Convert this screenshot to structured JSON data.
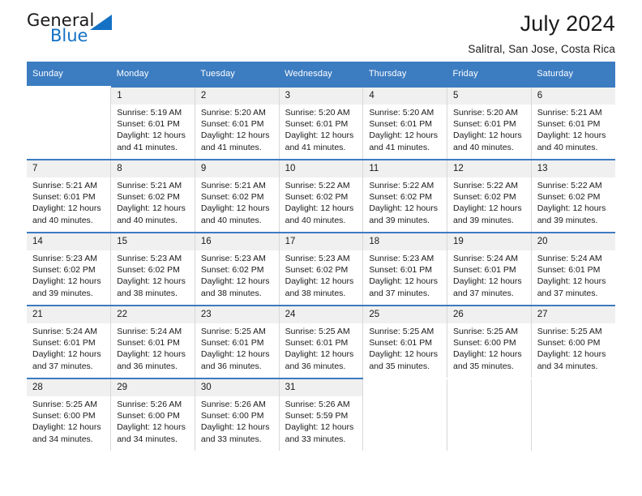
{
  "logo": {
    "word_top": "General",
    "word_bottom": "Blue",
    "triangle_color": "#1471c4",
    "icon": "general-blue-logo"
  },
  "header": {
    "title": "July 2024",
    "subtitle": "Salitral, San Jose, Costa Rica"
  },
  "theme": {
    "header_blue": "#3c7cc1",
    "daynum_band": "#f0f0f0",
    "text": "#1a1a1a"
  },
  "calendar": {
    "weekday_headers": [
      "Sunday",
      "Monday",
      "Tuesday",
      "Wednesday",
      "Thursday",
      "Friday",
      "Saturday"
    ],
    "weeks": [
      [
        {
          "day": "",
          "sunrise": "",
          "sunset": "",
          "daylight_line1": "",
          "daylight_line2": "",
          "empty": true
        },
        {
          "day": "1",
          "sunrise": "Sunrise: 5:19 AM",
          "sunset": "Sunset: 6:01 PM",
          "daylight_line1": "Daylight: 12 hours",
          "daylight_line2": "and 41 minutes."
        },
        {
          "day": "2",
          "sunrise": "Sunrise: 5:20 AM",
          "sunset": "Sunset: 6:01 PM",
          "daylight_line1": "Daylight: 12 hours",
          "daylight_line2": "and 41 minutes."
        },
        {
          "day": "3",
          "sunrise": "Sunrise: 5:20 AM",
          "sunset": "Sunset: 6:01 PM",
          "daylight_line1": "Daylight: 12 hours",
          "daylight_line2": "and 41 minutes."
        },
        {
          "day": "4",
          "sunrise": "Sunrise: 5:20 AM",
          "sunset": "Sunset: 6:01 PM",
          "daylight_line1": "Daylight: 12 hours",
          "daylight_line2": "and 41 minutes."
        },
        {
          "day": "5",
          "sunrise": "Sunrise: 5:20 AM",
          "sunset": "Sunset: 6:01 PM",
          "daylight_line1": "Daylight: 12 hours",
          "daylight_line2": "and 40 minutes."
        },
        {
          "day": "6",
          "sunrise": "Sunrise: 5:21 AM",
          "sunset": "Sunset: 6:01 PM",
          "daylight_line1": "Daylight: 12 hours",
          "daylight_line2": "and 40 minutes."
        }
      ],
      [
        {
          "day": "7",
          "sunrise": "Sunrise: 5:21 AM",
          "sunset": "Sunset: 6:01 PM",
          "daylight_line1": "Daylight: 12 hours",
          "daylight_line2": "and 40 minutes."
        },
        {
          "day": "8",
          "sunrise": "Sunrise: 5:21 AM",
          "sunset": "Sunset: 6:02 PM",
          "daylight_line1": "Daylight: 12 hours",
          "daylight_line2": "and 40 minutes."
        },
        {
          "day": "9",
          "sunrise": "Sunrise: 5:21 AM",
          "sunset": "Sunset: 6:02 PM",
          "daylight_line1": "Daylight: 12 hours",
          "daylight_line2": "and 40 minutes."
        },
        {
          "day": "10",
          "sunrise": "Sunrise: 5:22 AM",
          "sunset": "Sunset: 6:02 PM",
          "daylight_line1": "Daylight: 12 hours",
          "daylight_line2": "and 40 minutes."
        },
        {
          "day": "11",
          "sunrise": "Sunrise: 5:22 AM",
          "sunset": "Sunset: 6:02 PM",
          "daylight_line1": "Daylight: 12 hours",
          "daylight_line2": "and 39 minutes."
        },
        {
          "day": "12",
          "sunrise": "Sunrise: 5:22 AM",
          "sunset": "Sunset: 6:02 PM",
          "daylight_line1": "Daylight: 12 hours",
          "daylight_line2": "and 39 minutes."
        },
        {
          "day": "13",
          "sunrise": "Sunrise: 5:22 AM",
          "sunset": "Sunset: 6:02 PM",
          "daylight_line1": "Daylight: 12 hours",
          "daylight_line2": "and 39 minutes."
        }
      ],
      [
        {
          "day": "14",
          "sunrise": "Sunrise: 5:23 AM",
          "sunset": "Sunset: 6:02 PM",
          "daylight_line1": "Daylight: 12 hours",
          "daylight_line2": "and 39 minutes."
        },
        {
          "day": "15",
          "sunrise": "Sunrise: 5:23 AM",
          "sunset": "Sunset: 6:02 PM",
          "daylight_line1": "Daylight: 12 hours",
          "daylight_line2": "and 38 minutes."
        },
        {
          "day": "16",
          "sunrise": "Sunrise: 5:23 AM",
          "sunset": "Sunset: 6:02 PM",
          "daylight_line1": "Daylight: 12 hours",
          "daylight_line2": "and 38 minutes."
        },
        {
          "day": "17",
          "sunrise": "Sunrise: 5:23 AM",
          "sunset": "Sunset: 6:02 PM",
          "daylight_line1": "Daylight: 12 hours",
          "daylight_line2": "and 38 minutes."
        },
        {
          "day": "18",
          "sunrise": "Sunrise: 5:23 AM",
          "sunset": "Sunset: 6:01 PM",
          "daylight_line1": "Daylight: 12 hours",
          "daylight_line2": "and 37 minutes."
        },
        {
          "day": "19",
          "sunrise": "Sunrise: 5:24 AM",
          "sunset": "Sunset: 6:01 PM",
          "daylight_line1": "Daylight: 12 hours",
          "daylight_line2": "and 37 minutes."
        },
        {
          "day": "20",
          "sunrise": "Sunrise: 5:24 AM",
          "sunset": "Sunset: 6:01 PM",
          "daylight_line1": "Daylight: 12 hours",
          "daylight_line2": "and 37 minutes."
        }
      ],
      [
        {
          "day": "21",
          "sunrise": "Sunrise: 5:24 AM",
          "sunset": "Sunset: 6:01 PM",
          "daylight_line1": "Daylight: 12 hours",
          "daylight_line2": "and 37 minutes."
        },
        {
          "day": "22",
          "sunrise": "Sunrise: 5:24 AM",
          "sunset": "Sunset: 6:01 PM",
          "daylight_line1": "Daylight: 12 hours",
          "daylight_line2": "and 36 minutes."
        },
        {
          "day": "23",
          "sunrise": "Sunrise: 5:25 AM",
          "sunset": "Sunset: 6:01 PM",
          "daylight_line1": "Daylight: 12 hours",
          "daylight_line2": "and 36 minutes."
        },
        {
          "day": "24",
          "sunrise": "Sunrise: 5:25 AM",
          "sunset": "Sunset: 6:01 PM",
          "daylight_line1": "Daylight: 12 hours",
          "daylight_line2": "and 36 minutes."
        },
        {
          "day": "25",
          "sunrise": "Sunrise: 5:25 AM",
          "sunset": "Sunset: 6:01 PM",
          "daylight_line1": "Daylight: 12 hours",
          "daylight_line2": "and 35 minutes."
        },
        {
          "day": "26",
          "sunrise": "Sunrise: 5:25 AM",
          "sunset": "Sunset: 6:00 PM",
          "daylight_line1": "Daylight: 12 hours",
          "daylight_line2": "and 35 minutes."
        },
        {
          "day": "27",
          "sunrise": "Sunrise: 5:25 AM",
          "sunset": "Sunset: 6:00 PM",
          "daylight_line1": "Daylight: 12 hours",
          "daylight_line2": "and 34 minutes."
        }
      ],
      [
        {
          "day": "28",
          "sunrise": "Sunrise: 5:25 AM",
          "sunset": "Sunset: 6:00 PM",
          "daylight_line1": "Daylight: 12 hours",
          "daylight_line2": "and 34 minutes."
        },
        {
          "day": "29",
          "sunrise": "Sunrise: 5:26 AM",
          "sunset": "Sunset: 6:00 PM",
          "daylight_line1": "Daylight: 12 hours",
          "daylight_line2": "and 34 minutes."
        },
        {
          "day": "30",
          "sunrise": "Sunrise: 5:26 AM",
          "sunset": "Sunset: 6:00 PM",
          "daylight_line1": "Daylight: 12 hours",
          "daylight_line2": "and 33 minutes."
        },
        {
          "day": "31",
          "sunrise": "Sunrise: 5:26 AM",
          "sunset": "Sunset: 5:59 PM",
          "daylight_line1": "Daylight: 12 hours",
          "daylight_line2": "and 33 minutes."
        },
        {
          "day": "",
          "sunrise": "",
          "sunset": "",
          "daylight_line1": "",
          "daylight_line2": "",
          "empty": true
        },
        {
          "day": "",
          "sunrise": "",
          "sunset": "",
          "daylight_line1": "",
          "daylight_line2": "",
          "empty": true
        },
        {
          "day": "",
          "sunrise": "",
          "sunset": "",
          "daylight_line1": "",
          "daylight_line2": "",
          "empty": true
        }
      ]
    ]
  }
}
